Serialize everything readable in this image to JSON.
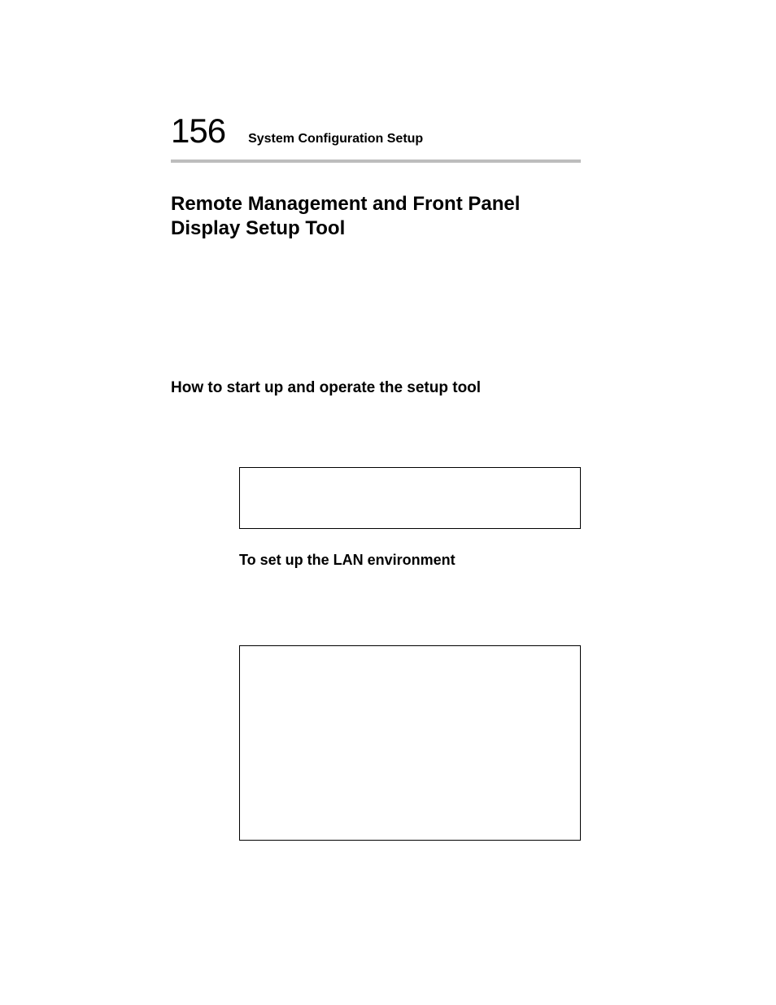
{
  "header": {
    "page_number": "156",
    "chapter_title": "System Configuration Setup"
  },
  "section": {
    "heading": "Remote Management and Front Panel Display Setup Tool"
  },
  "subsection": {
    "heading": "How to start up and operate the setup tool"
  },
  "inset": {
    "subheading": "To set up the LAN environment"
  }
}
